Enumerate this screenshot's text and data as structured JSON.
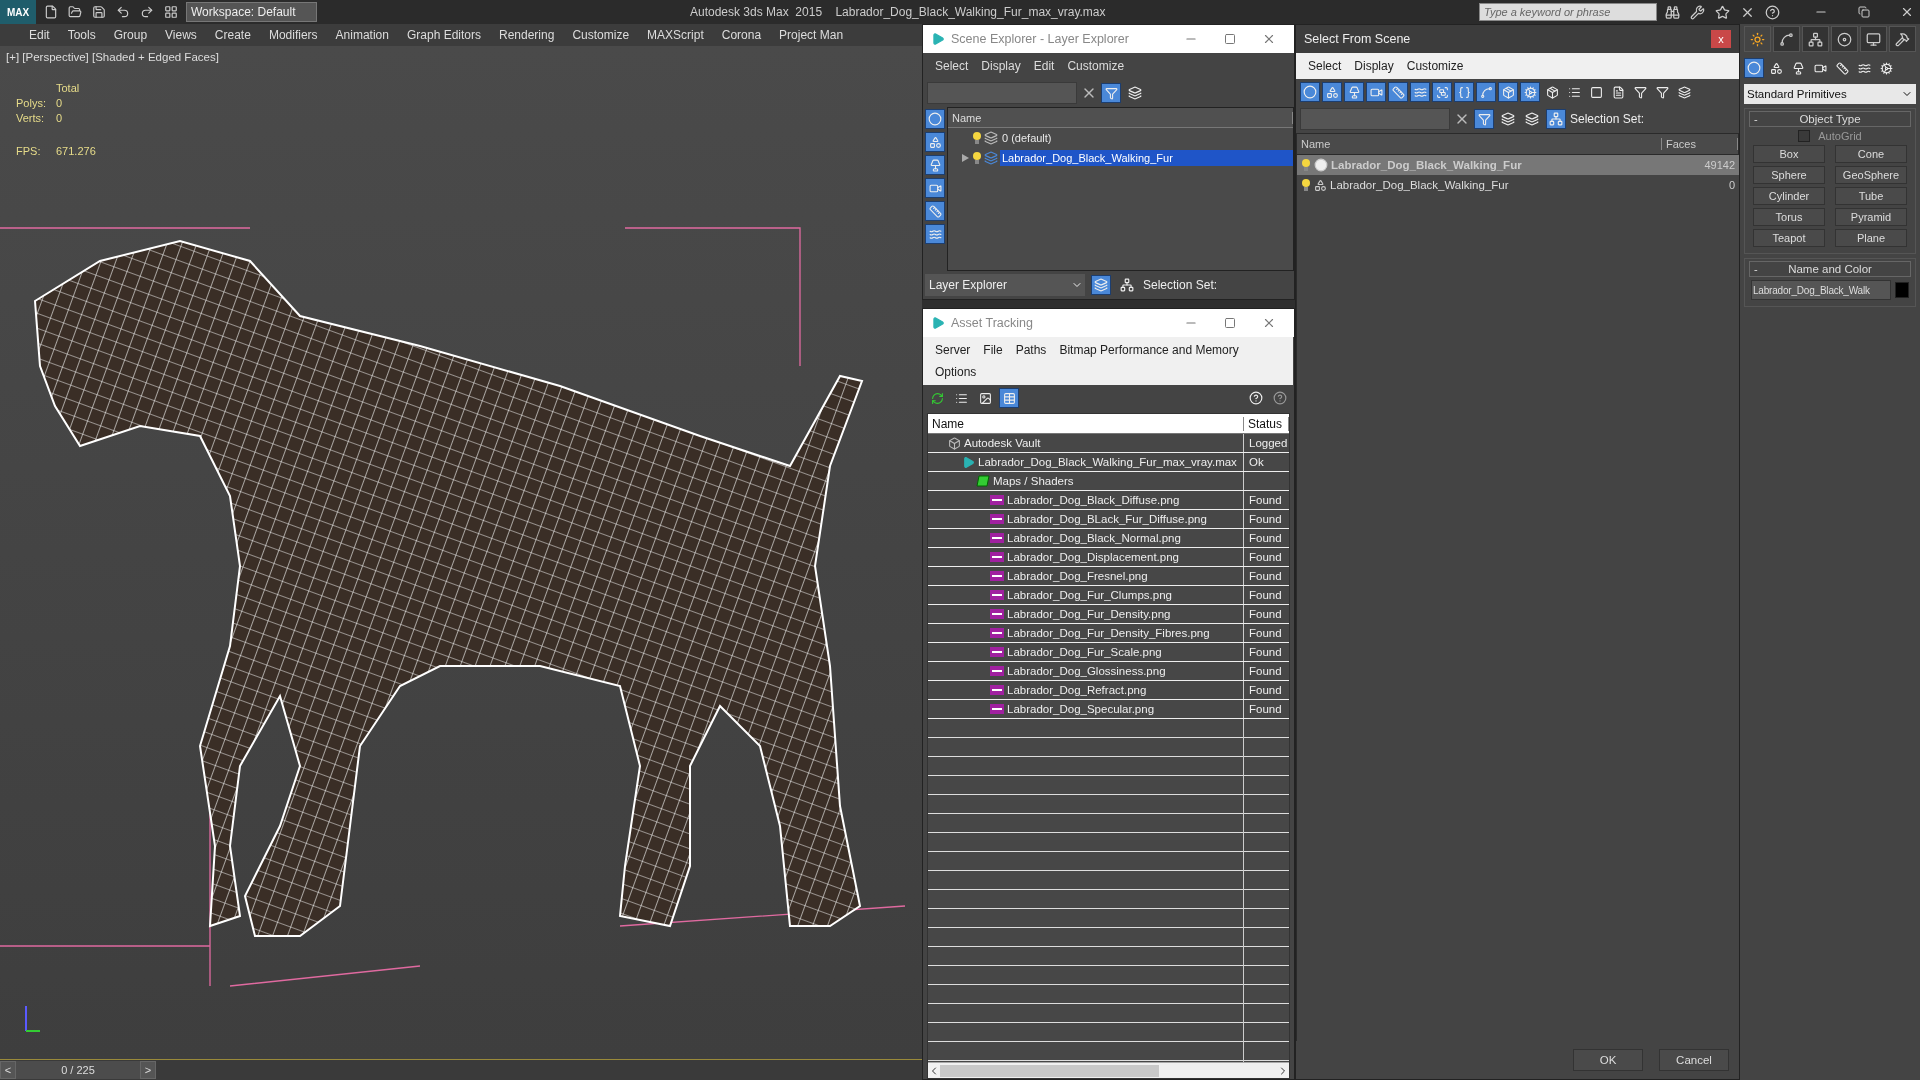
{
  "app_bar": {
    "logo": "MAX",
    "workspace": "Workspace: Default",
    "title": "Autodesk 3ds Max  2015    Labrador_Dog_Black_Walking_Fur_max_vray.max",
    "search": {
      "placeholder": "Type a keyword or phrase"
    }
  },
  "menu": [
    "Edit",
    "Tools",
    "Group",
    "Views",
    "Create",
    "Modifiers",
    "Animation",
    "Graph Editors",
    "Rendering",
    "Customize",
    "MAXScript",
    "Corona",
    "Project Man"
  ],
  "viewport": {
    "label": "[+] [Perspective] [Shaded + Edged Faces]",
    "stats": {
      "heading": "Total",
      "rows": [
        {
          "label": "Polys:",
          "value": "0"
        },
        {
          "label": "Verts:",
          "value": "0"
        }
      ]
    },
    "fps": {
      "label": "FPS:",
      "value": "671.276"
    }
  },
  "timeline": {
    "prev": "<",
    "position": "0 / 225",
    "next": ">"
  },
  "scene_explorer": {
    "title": "Scene Explorer - Layer Explorer",
    "menu": [
      "Select",
      "Display",
      "Edit",
      "Customize"
    ],
    "column": "Name",
    "layers": [
      {
        "name": "0 (default)",
        "selected": false
      },
      {
        "name": "Labrador_Dog_Black_Walking_Fur",
        "selected": true
      }
    ],
    "mode": "Layer Explorer",
    "selection_set": "Selection Set:"
  },
  "asset_tracking": {
    "title": "Asset Tracking",
    "menu": [
      "Server",
      "File",
      "Paths",
      "Bitmap Performance and Memory",
      "Options"
    ],
    "columns": [
      "Name",
      "Status"
    ],
    "rows": [
      {
        "kind": "vault",
        "name": "Autodesk Vault",
        "status": "Logged",
        "children": [
          {
            "kind": "file",
            "name": "Labrador_Dog_Black_Walking_Fur_max_vray.max",
            "status": "Ok",
            "children": [
              {
                "kind": "folder",
                "name": "Maps / Shaders",
                "children": [
                  {
                    "kind": "png",
                    "name": "Labrador_Dog_Black_Diffuse.png",
                    "status": "Found"
                  },
                  {
                    "kind": "png",
                    "name": "Labrador_Dog_BLack_Fur_Diffuse.png",
                    "status": "Found"
                  },
                  {
                    "kind": "png",
                    "name": "Labrador_Dog_Black_Normal.png",
                    "status": "Found"
                  },
                  {
                    "kind": "png",
                    "name": "Labrador_Dog_Displacement.png",
                    "status": "Found"
                  },
                  {
                    "kind": "png",
                    "name": "Labrador_Dog_Fresnel.png",
                    "status": "Found"
                  },
                  {
                    "kind": "png",
                    "name": "Labrador_Dog_Fur_Clumps.png",
                    "status": "Found"
                  },
                  {
                    "kind": "png",
                    "name": "Labrador_Dog_Fur_Density.png",
                    "status": "Found"
                  },
                  {
                    "kind": "png",
                    "name": "Labrador_Dog_Fur_Density_Fibres.png",
                    "status": "Found"
                  },
                  {
                    "kind": "png",
                    "name": "Labrador_Dog_Fur_Scale.png",
                    "status": "Found"
                  },
                  {
                    "kind": "png",
                    "name": "Labrador_Dog_Glossiness.png",
                    "status": "Found"
                  },
                  {
                    "kind": "png",
                    "name": "Labrador_Dog_Refract.png",
                    "status": "Found"
                  },
                  {
                    "kind": "png",
                    "name": "Labrador_Dog_Specular.png",
                    "status": "Found"
                  }
                ]
              }
            ]
          }
        ]
      }
    ]
  },
  "select_from_scene": {
    "title": "Select From Scene",
    "close": "x",
    "menu": [
      "Select",
      "Display",
      "Customize"
    ],
    "selection_set": "Selection Set:",
    "columns": [
      "Name",
      "Faces"
    ],
    "rows": [
      {
        "name": "Labrador_Dog_Black_Walking_Fur",
        "faces": "49142",
        "selected": true
      },
      {
        "name": "Labrador_Dog_Black_Walking_Fur",
        "faces": "0",
        "selected": false
      }
    ],
    "buttons": [
      "OK",
      "Cancel"
    ]
  },
  "command_panel": {
    "category": "Standard Primitives",
    "object_type": {
      "toggle": "-",
      "title": "Object Type",
      "autogrid": {
        "label": "AutoGrid",
        "checked": false
      },
      "buttons": [
        "Box",
        "Cone",
        "Sphere",
        "GeoSphere",
        "Cylinder",
        "Tube",
        "Torus",
        "Pyramid",
        "Teapot",
        "Plane"
      ]
    },
    "name_and_color": {
      "toggle": "-",
      "title": "Name and Color",
      "name": "Labrador_Dog_Black_Walk"
    }
  }
}
